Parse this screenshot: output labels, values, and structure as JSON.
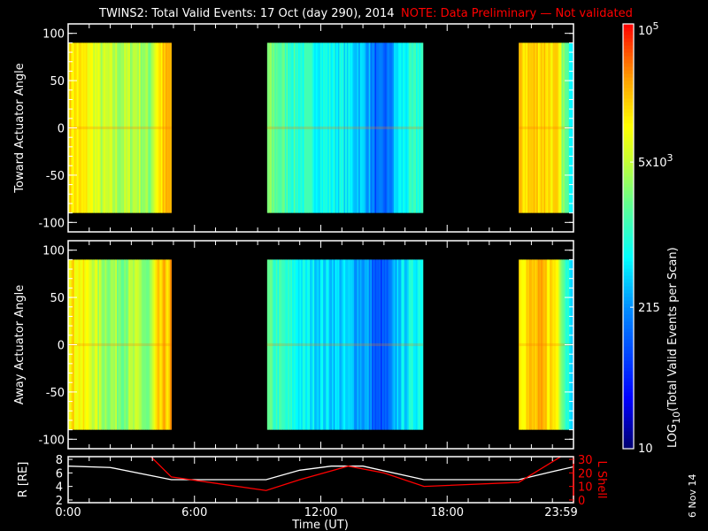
{
  "title": "TWINS2: Total Valid Events: 17 Oct (day 290), 2014",
  "note": "NOTE: Data Preliminary — Not validated",
  "date_stamp": "6 Nov 14",
  "colors": {
    "note": "#ff0000",
    "r_line": "#ffffff",
    "lshell_line": "#ff0000"
  },
  "chart_data": [
    {
      "type": "heatmap",
      "name": "toward",
      "ylabel": "Toward Actuator Angle",
      "ylim": [
        -110,
        110
      ],
      "yticks": [
        "100",
        "50",
        "0",
        "-50",
        "-100"
      ],
      "ytick_values": [
        100,
        50,
        0,
        -50,
        -100
      ],
      "data_angle_range": [
        -90,
        90
      ],
      "blocks": [
        {
          "start_hr": 0.0,
          "end_hr": 4.9,
          "profile": [
            [
              0,
              4.2
            ],
            [
              1.0,
              4.0
            ],
            [
              1.5,
              3.7
            ],
            [
              2.5,
              3.6
            ],
            [
              3.3,
              3.7
            ],
            [
              3.8,
              3.4
            ],
            [
              4.2,
              4.1
            ],
            [
              4.9,
              4.4
            ]
          ]
        },
        {
          "start_hr": 9.45,
          "end_hr": 16.85,
          "profile": [
            [
              9.45,
              3.4
            ],
            [
              10.2,
              3.2
            ],
            [
              11.0,
              3.0
            ],
            [
              12.0,
              2.9
            ],
            [
              13.0,
              2.8
            ],
            [
              14.2,
              2.5
            ],
            [
              14.6,
              2.0
            ],
            [
              15.2,
              2.1
            ],
            [
              15.6,
              2.7
            ],
            [
              16.85,
              3.1
            ]
          ]
        },
        {
          "start_hr": 21.4,
          "end_hr": 24.0,
          "profile": [
            [
              21.4,
              4.2
            ],
            [
              22.5,
              4.3
            ],
            [
              23.2,
              4.1
            ],
            [
              23.6,
              3.2
            ],
            [
              24.0,
              2.8
            ]
          ]
        }
      ]
    },
    {
      "type": "heatmap",
      "name": "away",
      "ylabel": "Away Actuator Angle",
      "ylim": [
        -110,
        110
      ],
      "yticks": [
        "100",
        "50",
        "0",
        "-50",
        "-100"
      ],
      "ytick_values": [
        100,
        50,
        0,
        -50,
        -100
      ],
      "data_angle_range": [
        -90,
        90
      ],
      "blocks": [
        {
          "start_hr": 0.0,
          "end_hr": 4.9,
          "profile": [
            [
              0,
              4.2
            ],
            [
              1.0,
              3.9
            ],
            [
              1.5,
              3.6
            ],
            [
              2.5,
              3.5
            ],
            [
              3.3,
              3.6
            ],
            [
              3.8,
              3.3
            ],
            [
              4.2,
              4.1
            ],
            [
              4.9,
              4.4
            ]
          ]
        },
        {
          "start_hr": 9.45,
          "end_hr": 16.85,
          "profile": [
            [
              9.45,
              3.2
            ],
            [
              10.2,
              3.0
            ],
            [
              11.0,
              2.8
            ],
            [
              12.0,
              2.7
            ],
            [
              13.0,
              2.6
            ],
            [
              14.2,
              2.4
            ],
            [
              14.6,
              1.9
            ],
            [
              15.2,
              2.0
            ],
            [
              15.6,
              2.6
            ],
            [
              16.85,
              3.0
            ]
          ]
        },
        {
          "start_hr": 21.4,
          "end_hr": 24.0,
          "profile": [
            [
              21.4,
              4.2
            ],
            [
              22.5,
              4.3
            ],
            [
              23.2,
              4.1
            ],
            [
              23.6,
              3.1
            ],
            [
              24.0,
              2.7
            ]
          ]
        }
      ]
    },
    {
      "type": "line",
      "name": "orbit",
      "ylabel": "R [RE]",
      "y2label": "L Shell",
      "ylim": [
        1.6,
        8.4
      ],
      "y2lim": [
        -2,
        32
      ],
      "yticks": [
        "8",
        "6",
        "4",
        "2"
      ],
      "ytick_values": [
        8,
        6,
        4,
        2
      ],
      "y2ticks": [
        "30",
        "20",
        "10",
        "0"
      ],
      "y2tick_values": [
        30,
        20,
        10,
        0
      ],
      "series": [
        {
          "name": "R",
          "x": [
            0,
            2,
            4.9,
            9.4,
            11,
            12.5,
            14,
            16.9,
            21.4,
            23,
            24
          ],
          "y": [
            7.0,
            6.8,
            5.0,
            5.0,
            6.4,
            7.0,
            7.0,
            5.0,
            5.0,
            6.2,
            6.9
          ]
        },
        {
          "name": "L Shell",
          "x": [
            3.8,
            4.9,
            9.4,
            11,
            13.3,
            15,
            16.9,
            21.4,
            23.4
          ],
          "y": [
            34,
            17,
            7,
            15,
            25,
            20,
            10,
            13,
            32
          ]
        }
      ]
    }
  ],
  "xaxis": {
    "label": "Time (UT)",
    "ticks": [
      "0:00",
      "6:00",
      "12:00",
      "18:00",
      "23:59"
    ],
    "tick_hours": [
      0,
      6,
      12,
      18,
      24
    ],
    "xlim": [
      0,
      24
    ]
  },
  "colorbar": {
    "label_prefix": "LOG",
    "label_sub": "10",
    "label_suffix": "(Total Valid Events per Scan)",
    "range_log": [
      1,
      5
    ],
    "ticks": [
      {
        "base": "10",
        "exp": "5",
        "log": 5
      },
      {
        "base": "5x10",
        "exp": "3",
        "log": 3.699
      },
      {
        "base": "215",
        "exp": "",
        "log": 2.332
      },
      {
        "base": "10",
        "exp": "",
        "log": 1
      }
    ]
  }
}
